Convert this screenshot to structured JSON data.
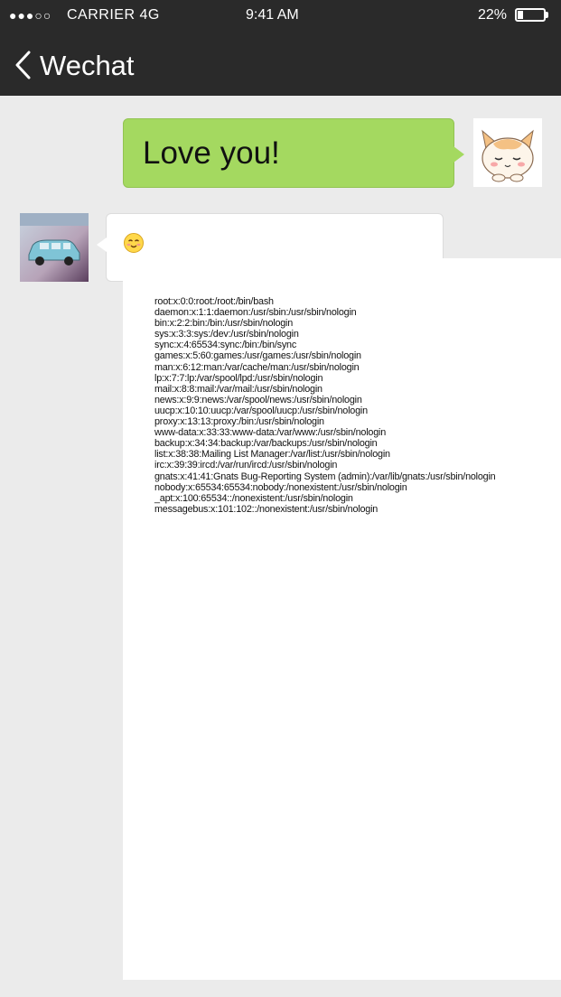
{
  "status_bar": {
    "signal": "●●●○○",
    "carrier": "CARRIER 4G",
    "time": "9:41  AM",
    "battery": "22%",
    "battery_level": 0.22
  },
  "nav": {
    "back_icon": "chevron-left-icon",
    "title": "Wechat"
  },
  "messages": [
    {
      "side": "right",
      "type": "text",
      "text": "Love you!",
      "avatar": "cartoon-cat-avatar"
    },
    {
      "side": "left",
      "type": "emoji",
      "emoji": "smiling-face-icon",
      "avatar": "toy-car-avatar"
    }
  ],
  "passwd_lines": [
    "root:x:0:0:root:/root:/bin/bash",
    "daemon:x:1:1:daemon:/usr/sbin:/usr/sbin/nologin",
    "bin:x:2:2:bin:/bin:/usr/sbin/nologin",
    "sys:x:3:3:sys:/dev:/usr/sbin/nologin",
    "sync:x:4:65534:sync:/bin:/bin/sync",
    "games:x:5:60:games:/usr/games:/usr/sbin/nologin",
    "man:x:6:12:man:/var/cache/man:/usr/sbin/nologin",
    "lp:x:7:7:lp:/var/spool/lpd:/usr/sbin/nologin",
    "mail:x:8:8:mail:/var/mail:/usr/sbin/nologin",
    "news:x:9:9:news:/var/spool/news:/usr/sbin/nologin",
    "uucp:x:10:10:uucp:/var/spool/uucp:/usr/sbin/nologin",
    "proxy:x:13:13:proxy:/bin:/usr/sbin/nologin",
    "www-data:x:33:33:www-data:/var/www:/usr/sbin/nologin",
    "backup:x:34:34:backup:/var/backups:/usr/sbin/nologin",
    "list:x:38:38:Mailing List Manager:/var/list:/usr/sbin/nologin",
    "irc:x:39:39:ircd:/var/run/ircd:/usr/sbin/nologin",
    "gnats:x:41:41:Gnats Bug-Reporting System (admin):/var/lib/gnats:/usr/sbin/nologin",
    "nobody:x:65534:65534:nobody:/nonexistent:/usr/sbin/nologin",
    "_apt:x:100:65534::/nonexistent:/usr/sbin/nologin",
    "messagebus:x:101:102::/nonexistent:/usr/sbin/nologin"
  ],
  "colors": {
    "header_bg": "#2a2a2a",
    "chat_bg": "#ebebeb",
    "sent_bubble": "#a4d960",
    "received_bubble": "#ffffff"
  }
}
